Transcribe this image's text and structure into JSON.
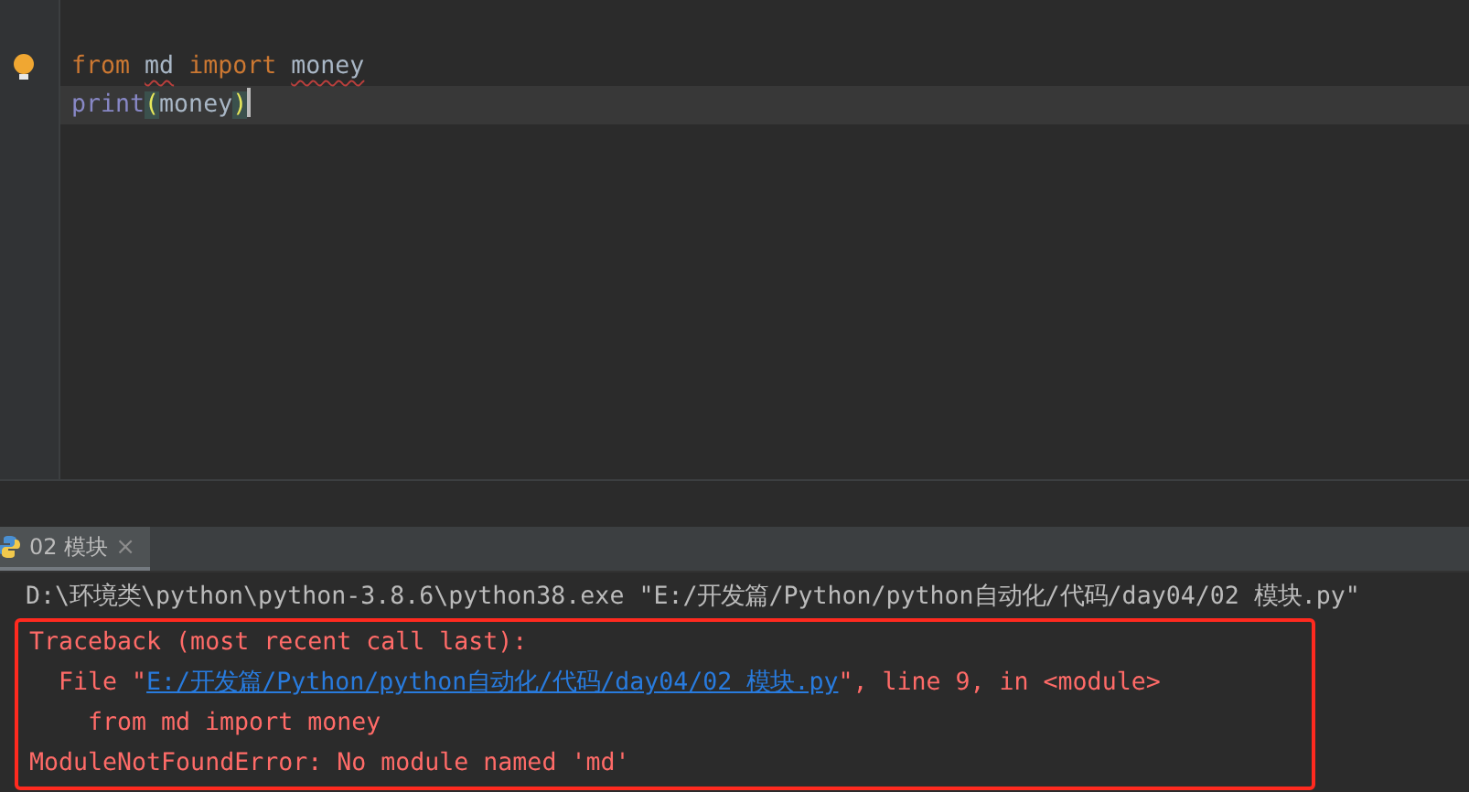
{
  "editor": {
    "lines": [
      {
        "current": false,
        "words": [
          [
            {
              "text": "from",
              "kind": "keyword",
              "error": false
            }
          ],
          [
            {
              "text": "md",
              "kind": "identifier",
              "error": true
            }
          ],
          [
            {
              "text": "import",
              "kind": "keyword",
              "error": false
            }
          ],
          [
            {
              "text": "money",
              "kind": "identifier",
              "error": true
            }
          ]
        ]
      },
      {
        "current": true,
        "words": [
          [
            {
              "text": "print",
              "kind": "builtin",
              "error": false
            },
            {
              "text": "(",
              "kind": "paren",
              "error": false
            },
            {
              "text": "money",
              "kind": "identifier",
              "error": false
            },
            {
              "text": ")",
              "kind": "paren",
              "error": false
            }
          ]
        ]
      }
    ]
  },
  "run_tab": {
    "label": "02 模块",
    "close": "×"
  },
  "console": {
    "lines": [
      {
        "segments": [
          {
            "text": "D:\\环境类\\python\\python-3.8.6\\python38.exe \"E:/开发篇/Python/python自动化/代码/day04/02 模块.py\"",
            "kind": "plain"
          }
        ]
      }
    ]
  },
  "error_box": [
    {
      "segments": [
        {
          "text": "Traceback (most recent call last):",
          "kind": "error"
        }
      ]
    },
    {
      "kind": "frame",
      "segments": [
        {
          "text": "File \"",
          "kind": "error"
        },
        {
          "text": "E:/开发篇/Python/python自动化/代码/day04/02 模块.py",
          "kind": "link"
        },
        {
          "text": "\", line 9, in <module>",
          "kind": "error"
        }
      ]
    },
    {
      "kind": "source",
      "segments": [
        {
          "text": "from md import money",
          "kind": "error"
        }
      ]
    },
    {
      "segments": [
        {
          "text": "ModuleNotFoundError: No module named 'md'",
          "kind": "error"
        }
      ]
    }
  ]
}
